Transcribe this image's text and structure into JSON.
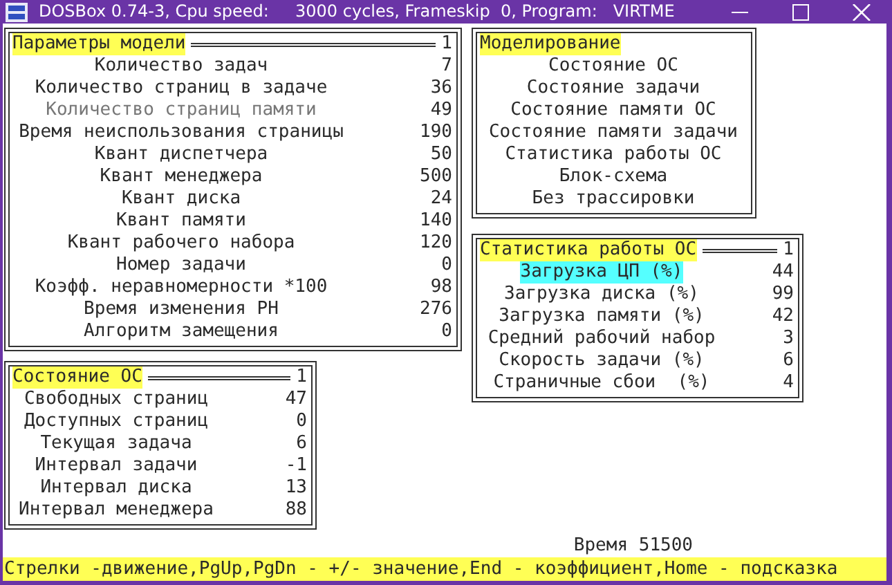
{
  "window": {
    "title": "DOSBox 0.74-3, Cpu speed:     3000 cycles, Frameskip  0, Program:   VIRTME"
  },
  "model_parameters": {
    "title": "Параметры модели",
    "page": "1",
    "rows": [
      {
        "label": "Количество задач",
        "value": "7",
        "dimmed": false
      },
      {
        "label": "Количество страниц в задаче",
        "value": "36",
        "dimmed": false
      },
      {
        "label": "Количество страниц памяти",
        "value": "49",
        "dimmed": true
      },
      {
        "label": "Время неиспользования страницы",
        "value": "190",
        "dimmed": false
      },
      {
        "label": "Квант диспетчера",
        "value": "50",
        "dimmed": false
      },
      {
        "label": "Квант менеджера",
        "value": "500",
        "dimmed": false
      },
      {
        "label": "Квант диска",
        "value": "24",
        "dimmed": false
      },
      {
        "label": "Квант памяти",
        "value": "140",
        "dimmed": false
      },
      {
        "label": "Квант рабочего набора",
        "value": "120",
        "dimmed": false
      },
      {
        "label": "Номер задачи",
        "value": "0",
        "dimmed": false
      },
      {
        "label": "Коэфф. неравномерности *100",
        "value": "98",
        "dimmed": false
      },
      {
        "label": "Время изменения РН",
        "value": "276",
        "dimmed": false
      },
      {
        "label": "Алгоритм замещения",
        "value": "0",
        "dimmed": false
      }
    ]
  },
  "os_state": {
    "title": "Состояние ОС",
    "page": "1",
    "rows": [
      {
        "label": "Свободных страниц",
        "value": "47"
      },
      {
        "label": "Доступных страниц",
        "value": "0"
      },
      {
        "label": "Текущая задача",
        "value": "6"
      },
      {
        "label": "Интервал задачи",
        "value": "-1"
      },
      {
        "label": "Интервал диска",
        "value": "13"
      },
      {
        "label": "Интервал менеджера",
        "value": "88"
      }
    ]
  },
  "modelling": {
    "title": "Моделирование",
    "items": [
      {
        "label": "Состояние ОС"
      },
      {
        "label": "Состояние задачи"
      },
      {
        "label": "Состояние памяти ОС"
      },
      {
        "label": "Состояние памяти задачи"
      },
      {
        "label": "Статистика работы ОС"
      },
      {
        "label": "Блок-схема"
      },
      {
        "label": "Без трассировки"
      }
    ]
  },
  "os_statistics": {
    "title": "Статистика работы ОС",
    "page": "1",
    "rows": [
      {
        "label": "Загрузка ЦП (%)",
        "value": "44",
        "selected": true
      },
      {
        "label": "Загрузка диска (%)",
        "value": "99",
        "selected": false
      },
      {
        "label": "Загрузка памяти (%)",
        "value": "42",
        "selected": false
      },
      {
        "label": "Средний рабочий набор",
        "value": "3",
        "selected": false
      },
      {
        "label": "Скорость задачи (%)",
        "value": "6",
        "selected": false
      },
      {
        "label": "Страничные сбои  (%)",
        "value": "4",
        "selected": false
      }
    ]
  },
  "time": "Время 51500",
  "hint_bar": "Стрелки -движение,PgUp,PgDn - +/- значение,End - коэффициент,Home - подсказка"
}
